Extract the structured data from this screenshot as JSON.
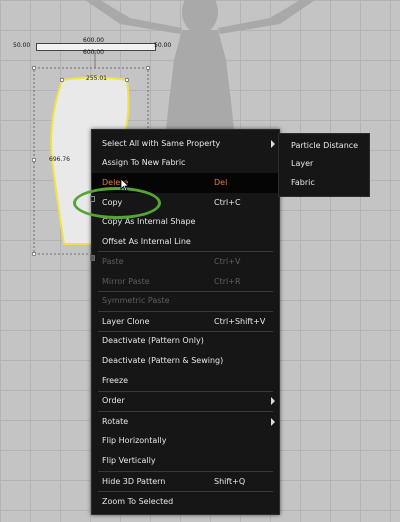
{
  "pattern": {
    "ruler_left": "50.00",
    "ruler_top": "600.00",
    "ruler_bottom": "600.00",
    "ruler_right": "50.00",
    "dim_top": "255.01",
    "dim_side": "696.76"
  },
  "context_menu": {
    "items": [
      {
        "label": "Select All with Same Property",
        "has_submenu": true
      },
      {
        "label": "Assign To New Fabric"
      },
      {
        "label": "Delete",
        "shortcut": "Del",
        "highlighted": true
      },
      {
        "label": "Copy",
        "shortcut": "Ctrl+C"
      },
      {
        "label": "Copy As Internal Shape"
      },
      {
        "label": "Offset As Internal Line"
      },
      {
        "label": "Paste",
        "shortcut": "Ctrl+V",
        "disabled": true
      },
      {
        "label": "Mirror Paste",
        "shortcut": "Ctrl+R",
        "disabled": true
      },
      {
        "label": "Symmetric Paste",
        "disabled": true
      },
      {
        "label": "Layer Clone",
        "shortcut": "Ctrl+Shift+V"
      },
      {
        "label": "Deactivate (Pattern Only)"
      },
      {
        "label": "Deactivate (Pattern & Sewing)"
      },
      {
        "label": "Freeze"
      },
      {
        "label": "Order",
        "has_submenu": true
      },
      {
        "label": "Rotate",
        "has_submenu": true
      },
      {
        "label": "Flip Horizontally"
      },
      {
        "label": "Flip Vertically"
      },
      {
        "label": "Hide 3D Pattern",
        "shortcut": "Shift+Q"
      },
      {
        "label": "Zoom To Selected"
      }
    ]
  },
  "submenu": {
    "items": [
      "Particle Distance",
      "Layer",
      "Fabric"
    ]
  },
  "colors": {
    "menu_bg": "#161616",
    "delete_text": "#e07a3e",
    "pattern_outline": "#f0e14a",
    "highlight_ring": "#55a534"
  }
}
